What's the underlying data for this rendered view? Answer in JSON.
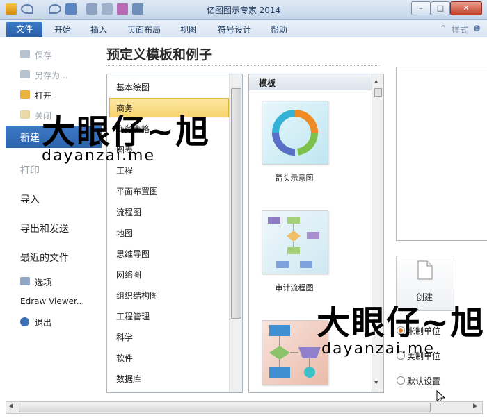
{
  "app": {
    "title": "亿图图示专家 2014"
  },
  "window_buttons": {
    "minimize": "–",
    "maximize": "□",
    "close": "✕"
  },
  "ribbon": {
    "tabs": [
      "文件",
      "开始",
      "插入",
      "页面布局",
      "视图",
      "符号设计",
      "帮助"
    ],
    "style_label": "样式"
  },
  "sidebar": {
    "save": "保存",
    "save_as": "另存为...",
    "open": "打开",
    "close": "关闭",
    "new": "新建",
    "print": "打印",
    "import": "导入",
    "export_send": "导出和发送",
    "recent": "最近的文件",
    "options": "选项",
    "viewer": "Edraw Viewer...",
    "exit": "退出"
  },
  "main": {
    "heading": "预定义模板和例子"
  },
  "categories": [
    "基本绘图",
    "商务",
    "商务表格",
    "图表",
    "工程",
    "平面布置图",
    "流程图",
    "地图",
    "思维导图",
    "网络图",
    "组织结构图",
    "工程管理",
    "科学",
    "软件",
    "数据库"
  ],
  "selected_category": "商务",
  "templates": {
    "header": "模板",
    "items": [
      {
        "label": "箭头示意图"
      },
      {
        "label": "审计流程图"
      },
      {
        "label": ""
      }
    ]
  },
  "right_panel": {
    "create_label": "创建",
    "units": [
      {
        "label": "米制单位",
        "selected": true
      },
      {
        "label": "美制单位",
        "selected": false
      },
      {
        "label": "默认设置",
        "selected": false
      }
    ]
  },
  "watermark": {
    "brand": "大眼仔~旭",
    "url": "dayanzai.me"
  }
}
